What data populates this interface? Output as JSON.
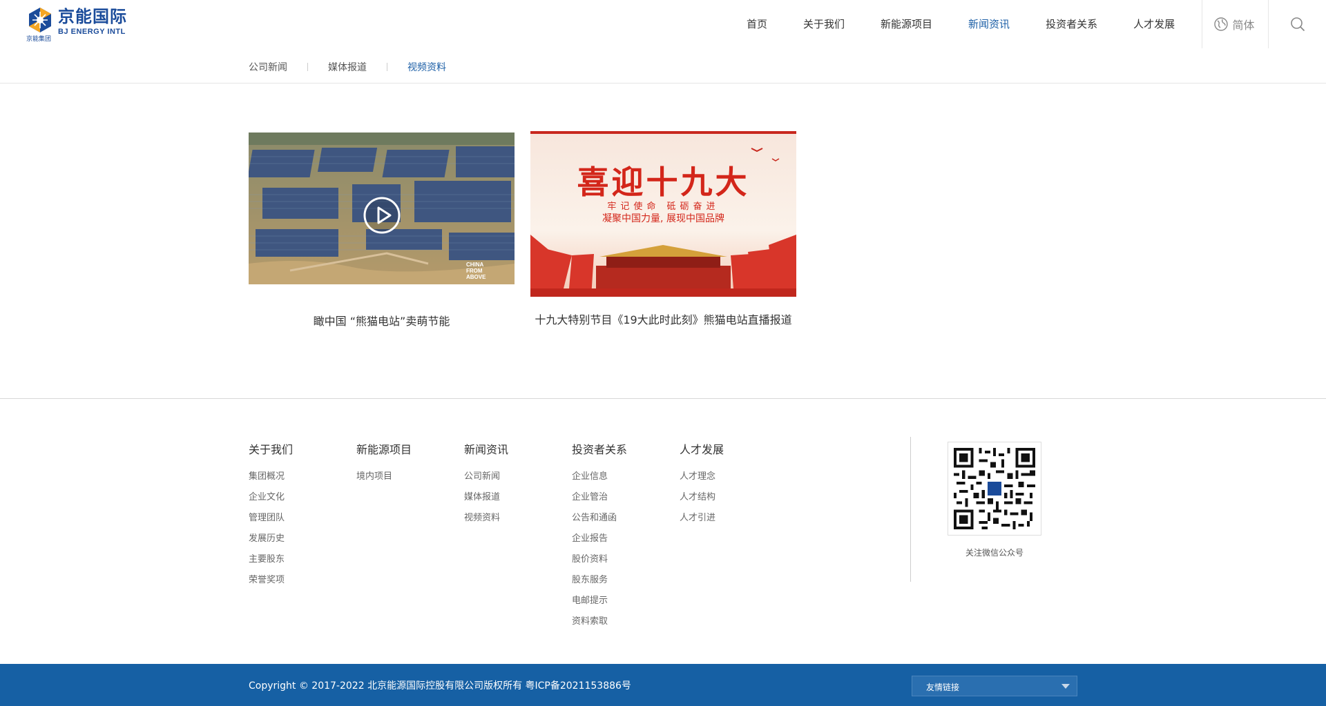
{
  "brand": {
    "name_cn": "京能国际",
    "name_en": "BJ ENERGY INTL",
    "group": "京能集团",
    "colors": {
      "primary": "#1b5ea6",
      "footer": "#1660a4",
      "logo_orange": "#f5a623"
    }
  },
  "nav": {
    "items": [
      {
        "label": "首页",
        "active": false
      },
      {
        "label": "关于我们",
        "active": false
      },
      {
        "label": "新能源项目",
        "active": false
      },
      {
        "label": "新闻资讯",
        "active": true
      },
      {
        "label": "投资者关系",
        "active": false
      },
      {
        "label": "人才发展",
        "active": false
      }
    ],
    "language": "简体",
    "language_icon": "globe-icon",
    "search_icon": "search-icon"
  },
  "subnav": {
    "items": [
      {
        "label": "公司新闻",
        "active": false
      },
      {
        "label": "媒体报道",
        "active": false
      },
      {
        "label": "视频资料",
        "active": true
      }
    ]
  },
  "videos": [
    {
      "title": "瞰中国 “熊猫电站”卖萌节能",
      "thumb_watermark": "CHINA FROM ABOVE",
      "play_icon": "play-icon"
    },
    {
      "title": "十九大特别节目《19大此时此刻》熊猫电站直播报道",
      "thumb_headline": "喜迎十九大",
      "thumb_line1": "牢记使命 砥砺奋进",
      "thumb_line2": "凝聚中国力量, 展现中国品牌"
    }
  ],
  "footer": {
    "columns": [
      {
        "title": "关于我们",
        "links": [
          "集团概况",
          "企业文化",
          "管理团队",
          "发展历史",
          "主要股东",
          "荣誉奖项"
        ]
      },
      {
        "title": "新能源项目",
        "links": [
          "境内项目"
        ]
      },
      {
        "title": "新闻资讯",
        "links": [
          "公司新闻",
          "媒体报道",
          "视频资料"
        ]
      },
      {
        "title": "投资者关系",
        "links": [
          "企业信息",
          "企业管治",
          "公告和通函",
          "企业报告",
          "股价资料",
          "股东服务",
          "电邮提示",
          "资料索取"
        ]
      },
      {
        "title": "人才发展",
        "links": [
          "人才理念",
          "人才结构",
          "人才引进"
        ]
      }
    ],
    "qr_caption": "关注微信公众号",
    "copyright": "Copyright © 2017-2022 北京能源国际控股有限公司版权所有 粤ICP备2021153886号",
    "friend_links_label": "友情链接"
  }
}
